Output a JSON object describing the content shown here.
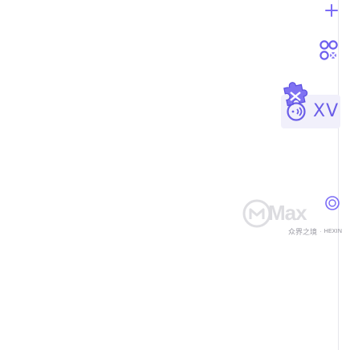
{
  "side_toolbar": {
    "add_icon": "plus-icon",
    "apps_icon": "grid-apps-icon",
    "extension_icon": "puzzle-icon",
    "translate_icon": "translate-icon",
    "translate_label": "XV",
    "record_icon": "circle-outline-icon"
  },
  "footer": {
    "badge_icon": "brand-icon",
    "text_cn": "众界之境",
    "brand": "HEXIN"
  },
  "watermark": {
    "text": "Max",
    "logo_icon": "watermark-logo-icon"
  },
  "colors": {
    "accent": "#7b6cf6",
    "accent_dark": "#5b4ee0",
    "badge_bg": "#f1f0fb",
    "edge": "#e6e6ec",
    "watermark": "#d8d8dc",
    "footer_text": "#9a9aa3"
  }
}
